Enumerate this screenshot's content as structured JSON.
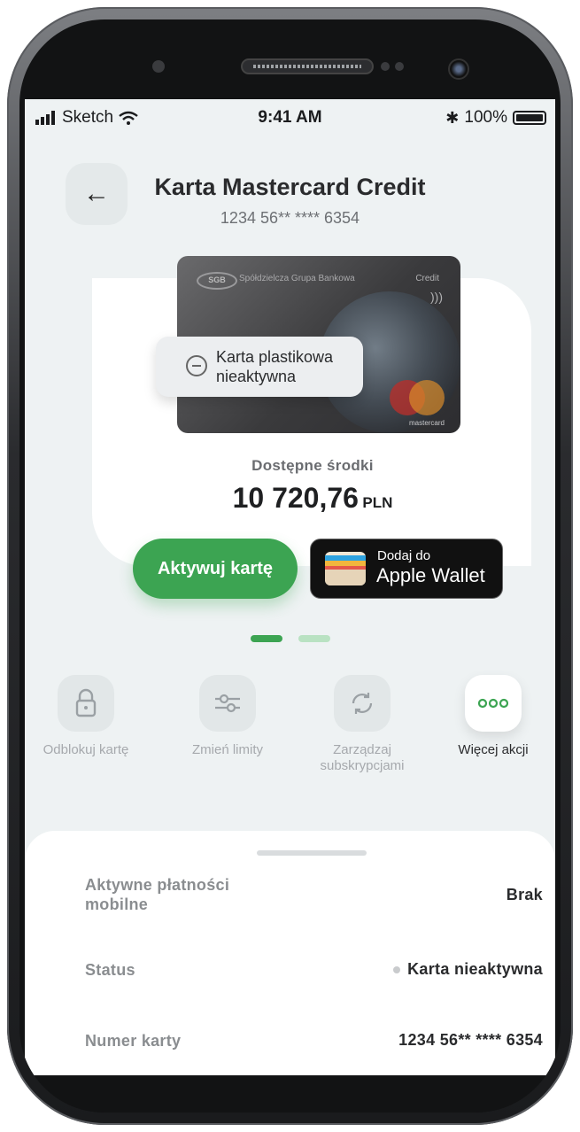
{
  "status_bar": {
    "carrier": "Sketch",
    "time": "9:41 AM",
    "battery": "100%"
  },
  "header": {
    "title": "Karta Mastercard Credit",
    "card_number_masked": "1234 56** **** 6354"
  },
  "card": {
    "bank_name": "Spółdzielcza Grupa Bankowa",
    "logo_text": "SGB",
    "type_label": "Credit",
    "network_label": "mastercard",
    "status_tag": "Karta plastikowa nieaktywna"
  },
  "funds": {
    "label": "Dostępne środki",
    "amount": "10 720,76",
    "currency": "PLN"
  },
  "buttons": {
    "activate": "Aktywuj kartę",
    "wallet_small": "Dodaj do",
    "wallet_big": "Apple Wallet"
  },
  "pager": {
    "active_color": "#3ca452",
    "inactive_color": "#b9e2c2"
  },
  "actions": [
    {
      "label": "Odblokuj kartę",
      "icon": "lock-icon"
    },
    {
      "label": "Zmień limity",
      "icon": "sliders-icon"
    },
    {
      "label": "Zarządzaj subskrypcjami",
      "icon": "refresh-icon"
    },
    {
      "label": "Więcej akcji",
      "icon": "more-icon"
    }
  ],
  "details": [
    {
      "key": "Aktywne płatności mobilne",
      "value": "Brak"
    },
    {
      "key": "Status",
      "value": "Karta nieaktywna"
    },
    {
      "key": "Numer karty",
      "value": "1234 56** **** 6354"
    }
  ],
  "colors": {
    "accent": "#3ca452",
    "background": "#eef2f3"
  }
}
